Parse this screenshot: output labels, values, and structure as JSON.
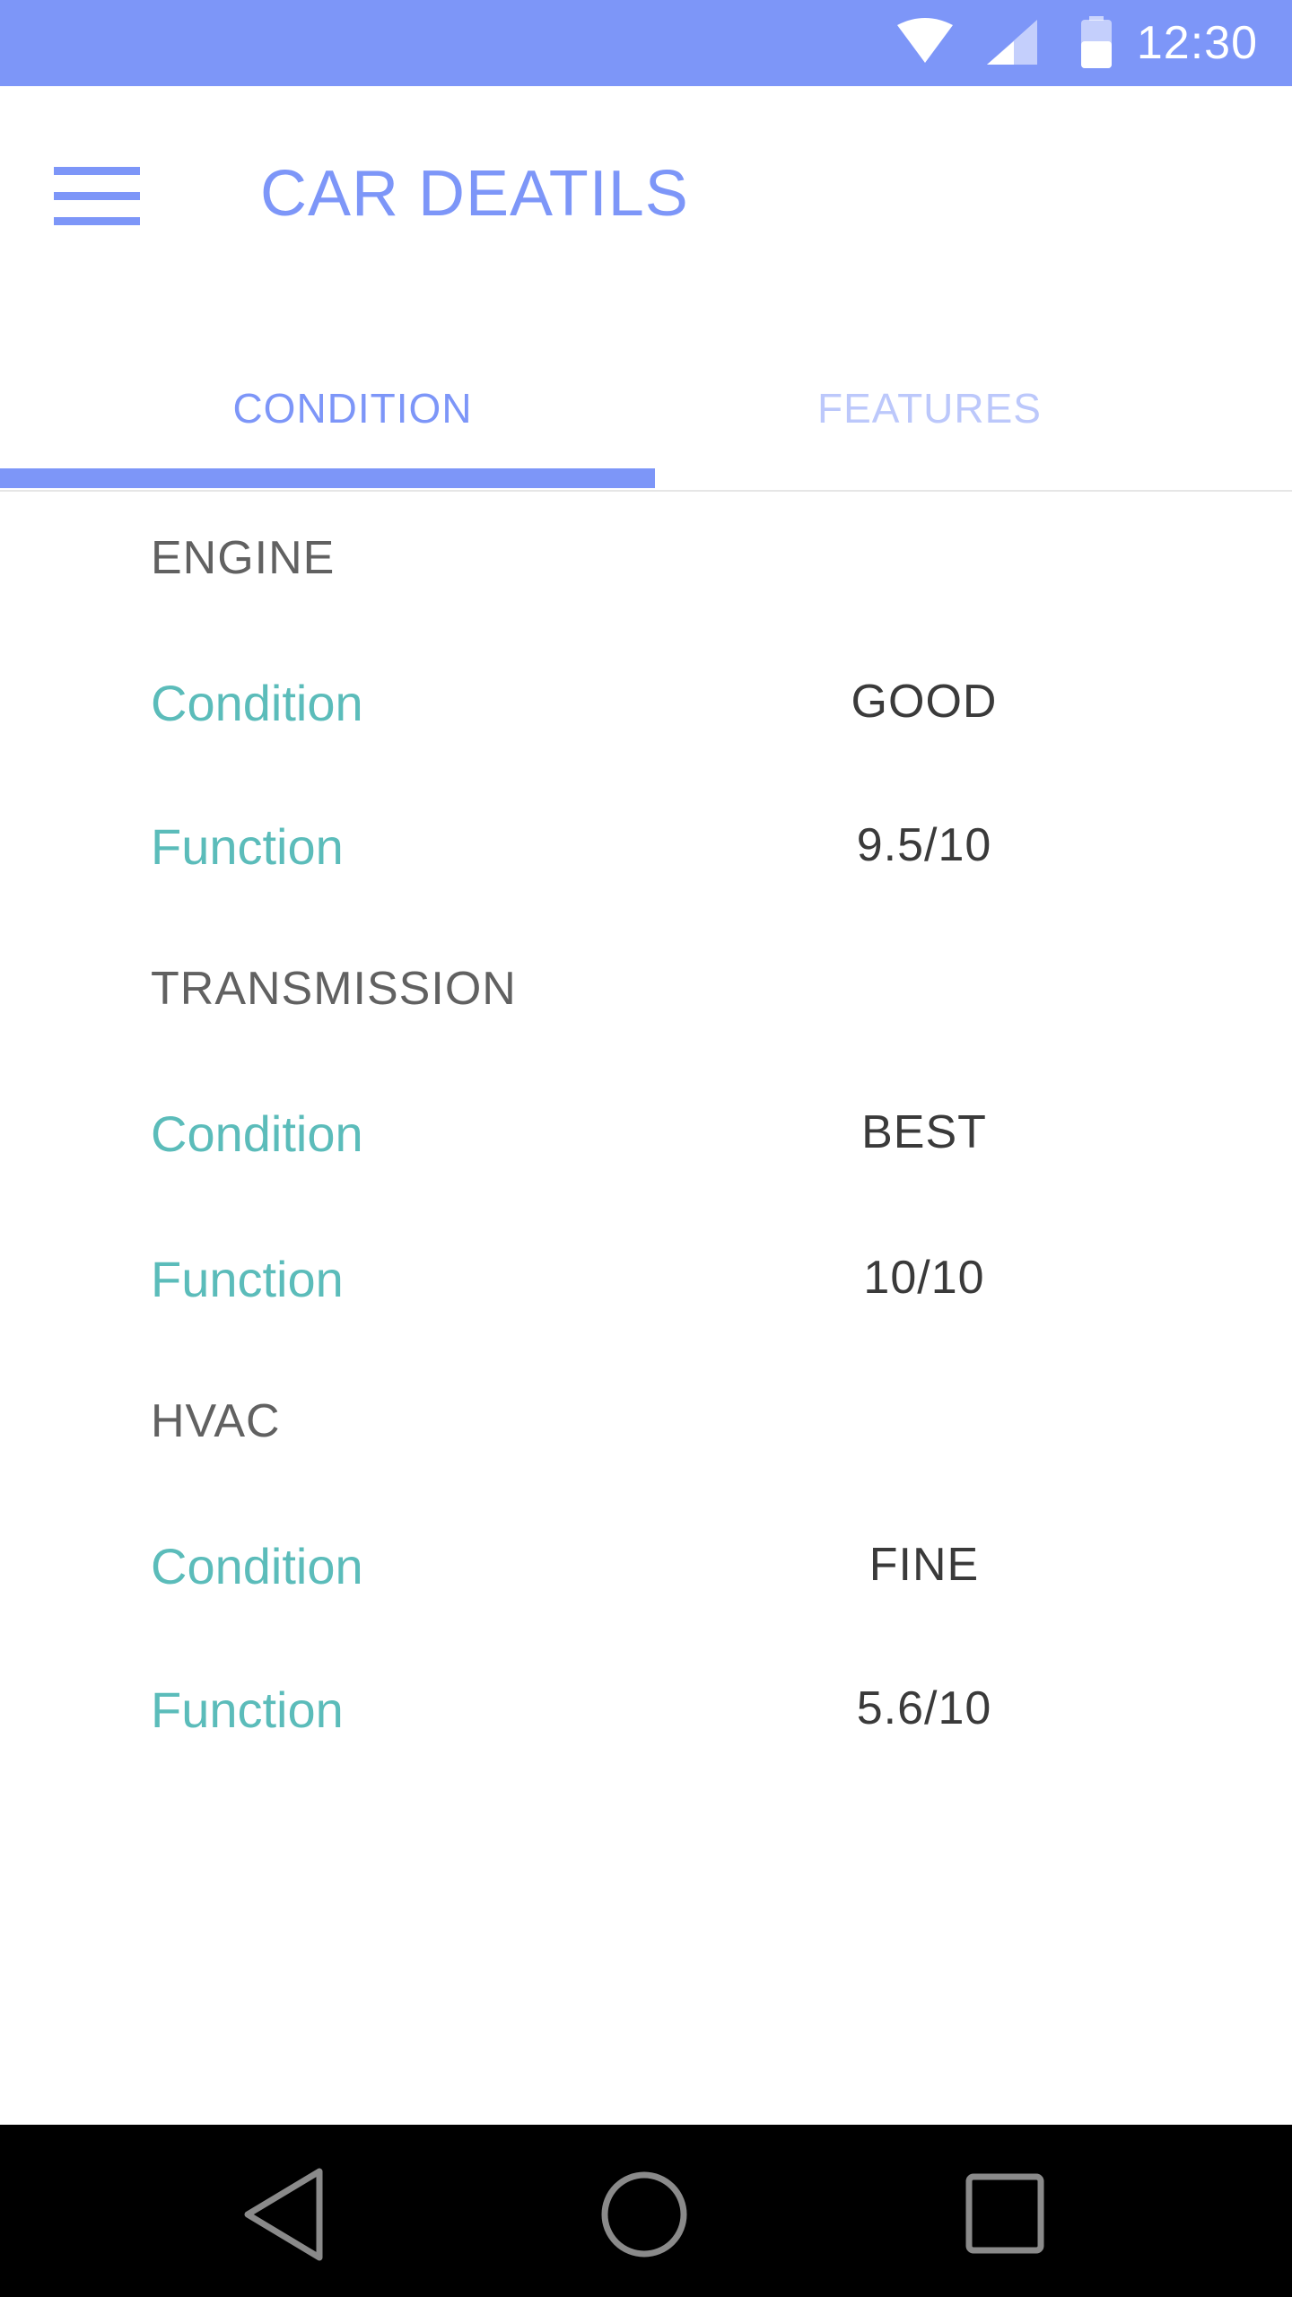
{
  "status_bar": {
    "time": "12:30",
    "icons": [
      "wifi-icon",
      "signal-icon",
      "battery-icon"
    ],
    "background": "#7d96f8"
  },
  "app_bar": {
    "title": "CAR DEATILS",
    "menu_icon": "hamburger-menu-icon",
    "accent": "#7d96f8"
  },
  "tabs": [
    {
      "label": "CONDITION",
      "selected": true
    },
    {
      "label": "FEATURES",
      "selected": false
    }
  ],
  "sections": [
    {
      "header": "ENGINE",
      "rows": [
        {
          "label": "Condition",
          "value": "GOOD"
        },
        {
          "label": "Function",
          "value": "9.5/10"
        }
      ]
    },
    {
      "header": "TRANSMISSION",
      "rows": [
        {
          "label": "Condition",
          "value": "BEST"
        },
        {
          "label": "Function",
          "value": "10/10"
        }
      ]
    },
    {
      "header": "HVAC",
      "rows": [
        {
          "label": "Condition",
          "value": "FINE"
        },
        {
          "label": "Function",
          "value": "5.6/10"
        }
      ]
    }
  ],
  "nav_bar": {
    "icons": [
      "back-icon",
      "home-icon",
      "recents-icon"
    ]
  },
  "colors": {
    "accent": "#7d96f8",
    "accent_light": "#bcc8fb",
    "label": "#5bbcba",
    "header": "#616161",
    "value": "#3a3a3a"
  }
}
